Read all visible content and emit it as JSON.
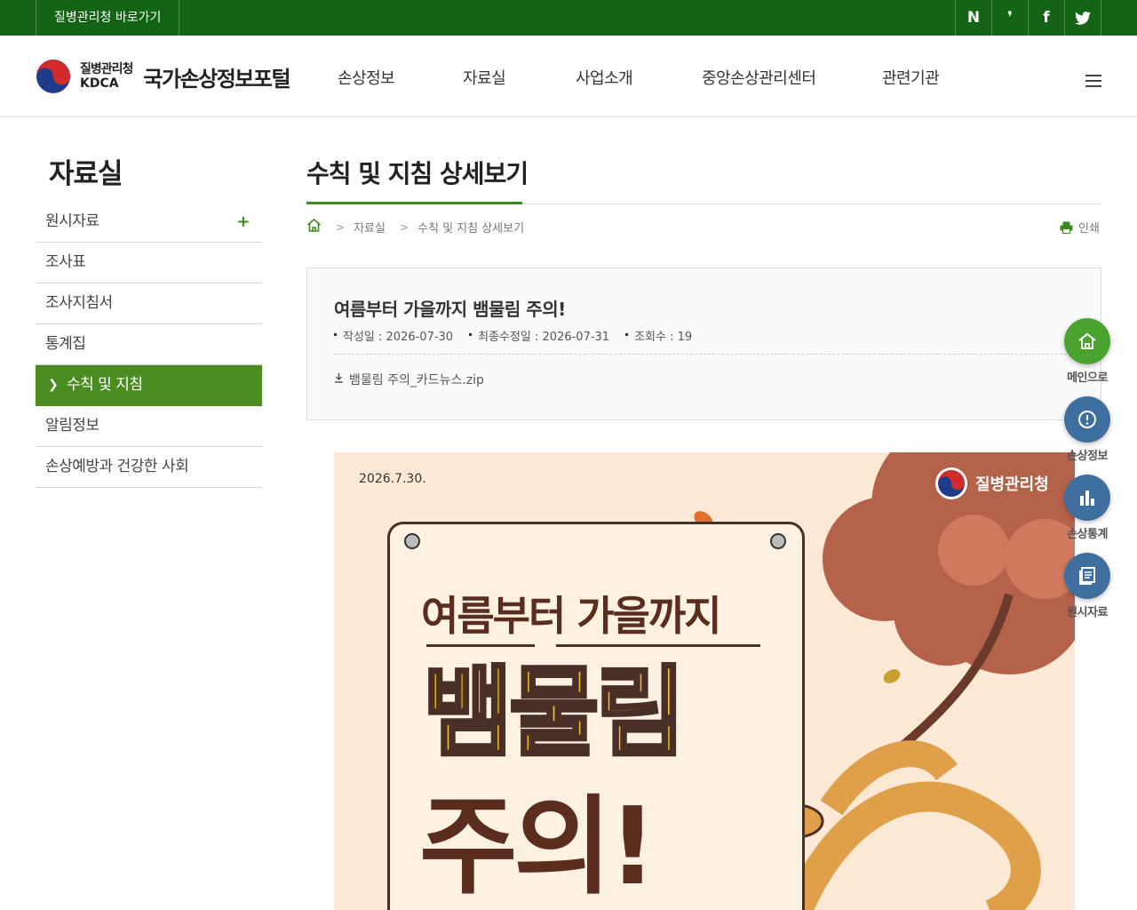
{
  "topbar": {
    "shortcut": "질병관리청 바로가기",
    "sns": [
      "N",
      "❜",
      "f",
      "t"
    ]
  },
  "header": {
    "logo_org_ko": "질병관리청",
    "logo_org_en": "KDCA",
    "logo_portal": "국가손상정보포털",
    "nav": [
      "손상정보",
      "자료실",
      "사업소개",
      "중앙손상관리센터",
      "관련기관"
    ],
    "menu_icon": "hamburger-icon"
  },
  "sidebar": {
    "title": "자료실",
    "items": [
      {
        "label": "원시자료",
        "expand": "+"
      },
      {
        "label": "조사표"
      },
      {
        "label": "조사지침서"
      },
      {
        "label": "통계집"
      },
      {
        "label": "수칙 및 지침"
      },
      {
        "label": "알림정보"
      },
      {
        "label": "손상예방과 건강한 사회"
      }
    ],
    "active_index": 4
  },
  "content": {
    "title": "수칙 및 지침 상세보기",
    "breadcrumb": [
      "자료실",
      "수칙 및 지침 상세보기"
    ],
    "print_label": "인쇄"
  },
  "post": {
    "title": "여름부터 가을까지 뱀물림 주의!",
    "created": "작성일 : 2026-07-30",
    "modified": "최종수정일 : 2026-07-31",
    "views": "조회수 : 19",
    "attachment": "뱀물림 주의_카드뉴스.zip"
  },
  "card": {
    "date": "2026.7.30.",
    "badge": "질병관리청",
    "headline_sub": "여름부터 가을까지",
    "headline_main": "뱀물림",
    "headline_warn": "주의!"
  },
  "quick_menu": [
    {
      "label": "메인으로",
      "icon": "home-icon",
      "color": "#4aa32e"
    },
    {
      "label": "손상정보",
      "icon": "alert-icon",
      "color": "#3f6f9f"
    },
    {
      "label": "손상통계",
      "icon": "bar-chart-icon",
      "color": "#3f6f9f"
    },
    {
      "label": "원시자료",
      "icon": "document-icon",
      "color": "#3f6f9f"
    }
  ],
  "colors": {
    "topbar": "#136414",
    "accent": "#4a8c20",
    "quick_home": "#4aa32e",
    "quick_other": "#3f6f9f"
  }
}
